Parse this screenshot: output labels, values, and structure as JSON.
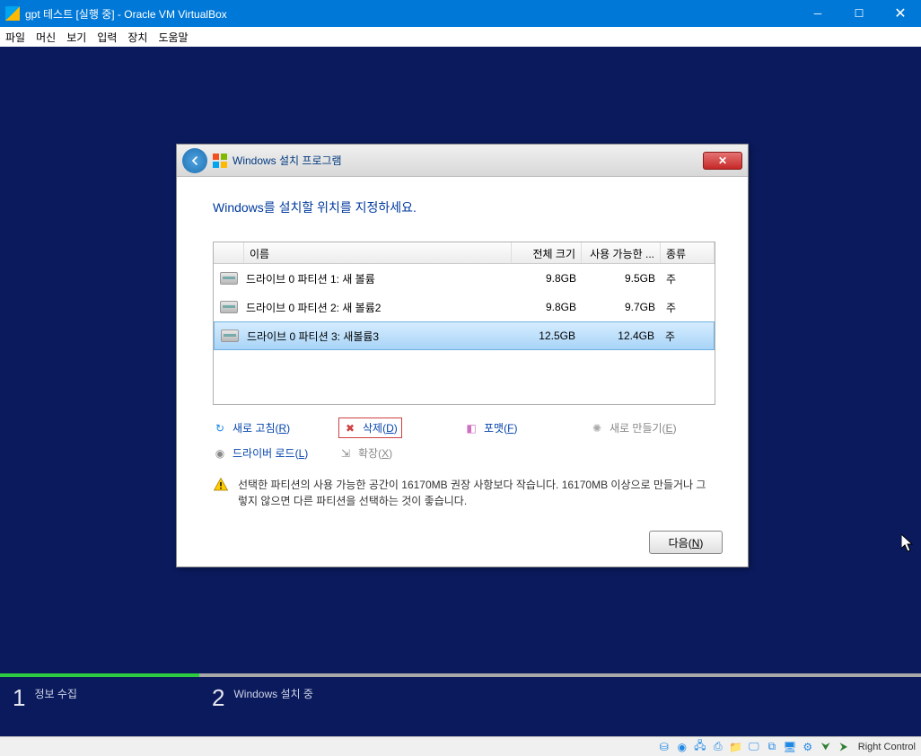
{
  "vb": {
    "title": "gpt 테스트 [실행 중] - Oracle VM VirtualBox",
    "menu": {
      "file": "파일",
      "machine": "머신",
      "view": "보기",
      "input": "입력",
      "devices": "장치",
      "help": "도움말"
    }
  },
  "setup": {
    "program_title": "Windows 설치 프로그램",
    "heading": "Windows를 설치할 위치를 지정하세요.",
    "columns": {
      "name": "이름",
      "total": "전체 크기",
      "free": "사용 가능한 ...",
      "type": "종류"
    },
    "rows": [
      {
        "name": "드라이브 0 파티션 1: 새 볼륨",
        "total": "9.8GB",
        "free": "9.5GB",
        "type": "주",
        "selected": false
      },
      {
        "name": "드라이브 0 파티션 2: 새 볼륨2",
        "total": "9.8GB",
        "free": "9.7GB",
        "type": "주",
        "selected": false
      },
      {
        "name": "드라이브 0 파티션 3: 새볼륨3",
        "total": "12.5GB",
        "free": "12.4GB",
        "type": "주",
        "selected": true
      }
    ],
    "actions": {
      "refresh": {
        "label": "새로 고침",
        "accel": "R"
      },
      "delete": {
        "label": "삭제",
        "accel": "D"
      },
      "format": {
        "label": "포맷",
        "accel": "F"
      },
      "new": {
        "label": "새로 만들기",
        "accel": "E"
      },
      "load_drv": {
        "label": "드라이버 로드",
        "accel": "L"
      },
      "extend": {
        "label": "확장",
        "accel": "X"
      }
    },
    "warning": "선택한 파티션의 사용 가능한 공간이 16170MB 권장 사항보다 작습니다. 16170MB 이상으로 만들거나 그렇지 않으면 다른 파티션을 선택하는 것이 좋습니다.",
    "next": {
      "label": "다음",
      "accel": "N"
    }
  },
  "steps": {
    "s1": {
      "num": "1",
      "label": "정보 수집"
    },
    "s2": {
      "num": "2",
      "label": "Windows 설치 중"
    }
  },
  "statusbar": {
    "hostkey": "Right Control"
  }
}
